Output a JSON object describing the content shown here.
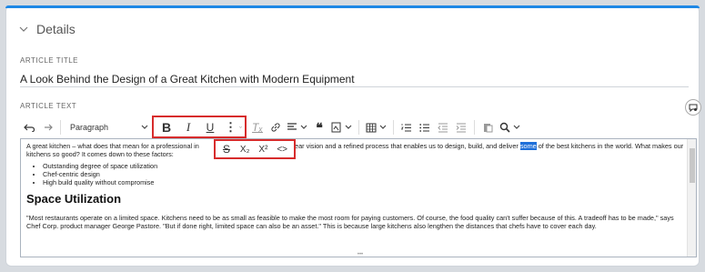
{
  "details": {
    "title": "Details"
  },
  "article_title": {
    "label": "ARTICLE TITLE",
    "value": "A Look Behind the Design of a Great Kitchen with Modern Equipment"
  },
  "article_text": {
    "label": "ARTICLE TEXT"
  },
  "toolbar": {
    "paragraph_select": "Paragraph",
    "bold": "B",
    "italic": "I",
    "underline": "U",
    "more": "⋮",
    "clear_formatting": "Tₓ",
    "quote": "❝",
    "strikethrough": "S",
    "subscript": "X₂",
    "superscript": "X²",
    "code": "<>"
  },
  "editor": {
    "paragraph_part1": "A great kitchen – what does that mean for a professional in ",
    "paragraph_part2": "rp., we have a clear vision and a refined process that enables us to design, build, and deliver ",
    "paragraph_highlight": "some",
    "paragraph_part3": " of the best kitchens in the world. What makes our kitchens so good? It comes down to these factors:",
    "bullets": [
      "Outstanding degree of space utilization",
      "Chef-centric design",
      "High build quality without compromise"
    ],
    "heading": "Space Utilization",
    "paragraph2": "\"Most restaurants operate on a limited space. Kitchens need to be as small as feasible to make the most room for paying customers. Of course, the food quality can't suffer because of this. A tradeoff has to be made,\" says Chef Corp. product manager George Pastore. \"But if done right, limited space can also be an asset.\" This is because large kitchens also lengthen the distances that chefs have to cover each day."
  },
  "colors": {
    "accent": "#1e88e5",
    "highlight_outline": "#d72c2c",
    "selection": "#1e6fd9"
  }
}
